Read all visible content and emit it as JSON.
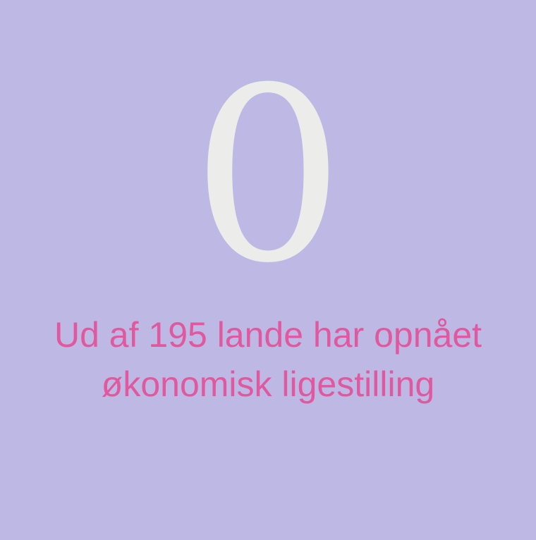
{
  "stat": {
    "number": "0",
    "caption_line1": "Ud af 195 lande har opnået",
    "caption_line2": "økonomisk ligestilling"
  },
  "colors": {
    "background": "#bdb8e4",
    "number": "#ececea",
    "caption": "#e0589e"
  }
}
